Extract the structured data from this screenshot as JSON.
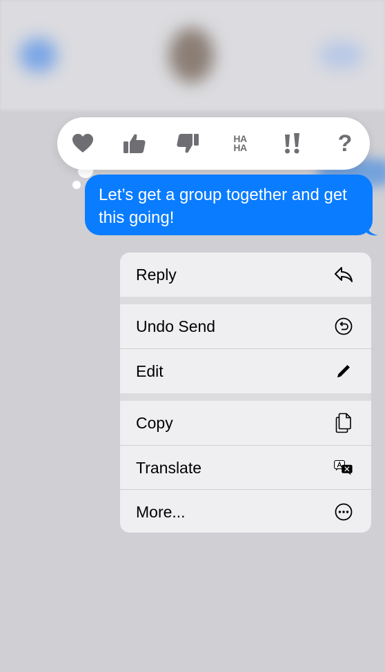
{
  "message": {
    "text": "Let’s get a group together and get this going!",
    "bubble_color": "#0a7cff"
  },
  "tapbacks": [
    {
      "name": "heart",
      "icon": "heart-icon"
    },
    {
      "name": "thumbs-up",
      "icon": "thumbs-up-icon"
    },
    {
      "name": "thumbs-down",
      "icon": "thumbs-down-icon"
    },
    {
      "name": "haha",
      "icon": "haha-icon",
      "line1": "HA",
      "line2": "HA"
    },
    {
      "name": "emphasize",
      "icon": "double-exclamation-icon",
      "label": "!!"
    },
    {
      "name": "question",
      "icon": "question-icon",
      "label": "?"
    }
  ],
  "menu": {
    "reply": {
      "label": "Reply",
      "icon": "reply-arrow-icon"
    },
    "undo_send": {
      "label": "Undo Send",
      "icon": "undo-circle-icon"
    },
    "edit": {
      "label": "Edit",
      "icon": "pencil-icon"
    },
    "copy": {
      "label": "Copy",
      "icon": "copy-icon"
    },
    "translate": {
      "label": "Translate",
      "icon": "translate-icon"
    },
    "more": {
      "label": "More...",
      "icon": "ellipsis-circle-icon"
    }
  }
}
